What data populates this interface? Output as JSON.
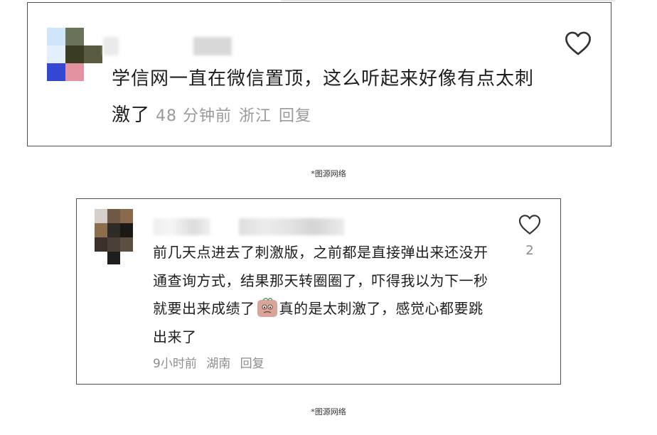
{
  "comments": [
    {
      "text": "学信网一直在微信置顶，这么听起来好像有点太刺激了",
      "time": "48 分钟前",
      "location": "浙江",
      "reply_label": "回复",
      "like_icon": "heart-outline-icon"
    },
    {
      "text_before_emoji": "前几天点进去了刺激版，之前都是直接弹出来还没开通查询方式，结果那天转圈圈了，吓得我以为下一秒就要出来成绩了",
      "emoji": "nervous-emoji-icon",
      "text_after_emoji": "真的是太刺激了，感觉心都要跳出来了",
      "time": "9小时前",
      "location": "湖南",
      "reply_label": "回复",
      "like_icon": "heart-outline-icon",
      "like_count": "2"
    }
  ],
  "captions": [
    "*图源网络",
    "*图源网络"
  ],
  "colors": {
    "text": "#1e1e1e",
    "meta": "#9a9a9a",
    "border": "#505050"
  }
}
